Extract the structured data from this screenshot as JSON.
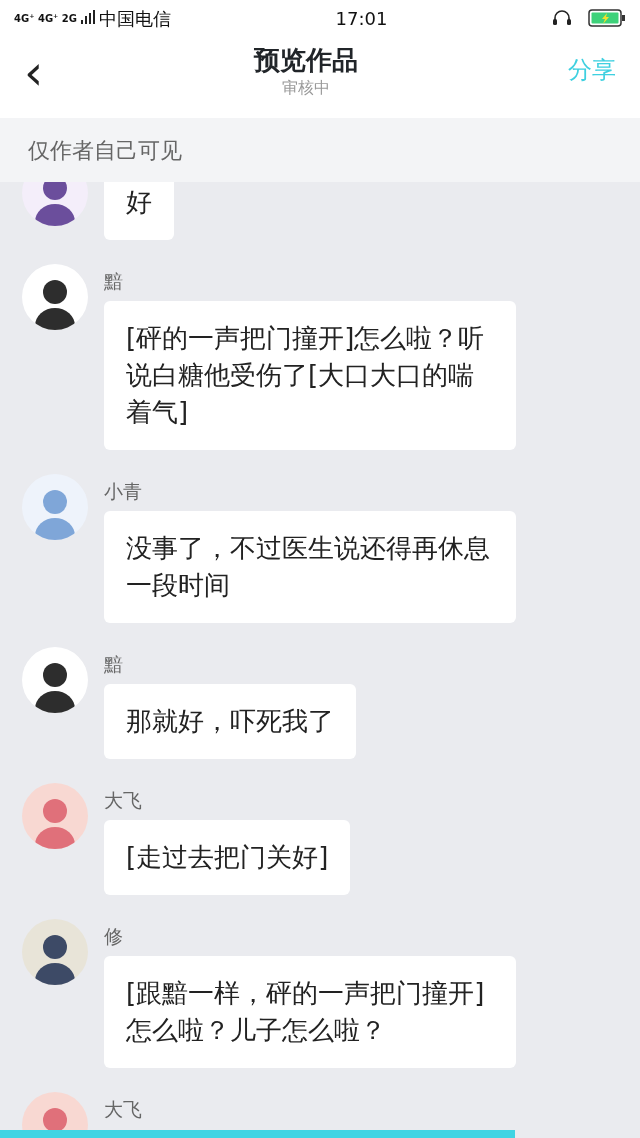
{
  "status_bar": {
    "network": "4G⁺ 4G⁺ 2G",
    "carrier": "中国电信",
    "time": "17:01",
    "battery_charging": true
  },
  "header": {
    "back": "‹",
    "title": "预览作品",
    "subtitle": "审核中",
    "action": "分享"
  },
  "notice": "仅作者自己可见",
  "messages": [
    {
      "text": "好"
    },
    {
      "name": "黯",
      "text": "[砰的一声把门撞开]怎么啦？听说白糖他受伤了[大口大口的喘着气]"
    },
    {
      "name": "小青",
      "text": "没事了，不过医生说还得再休息一段时间"
    },
    {
      "name": "黯",
      "text": "那就好，吓死我了"
    },
    {
      "name": "大飞",
      "text": "[走过去把门关好]"
    },
    {
      "name": "修",
      "text": "[跟黯一样，砰的一声把门撞开]怎么啦？儿子怎么啦？"
    },
    {
      "name": "大飞"
    }
  ]
}
